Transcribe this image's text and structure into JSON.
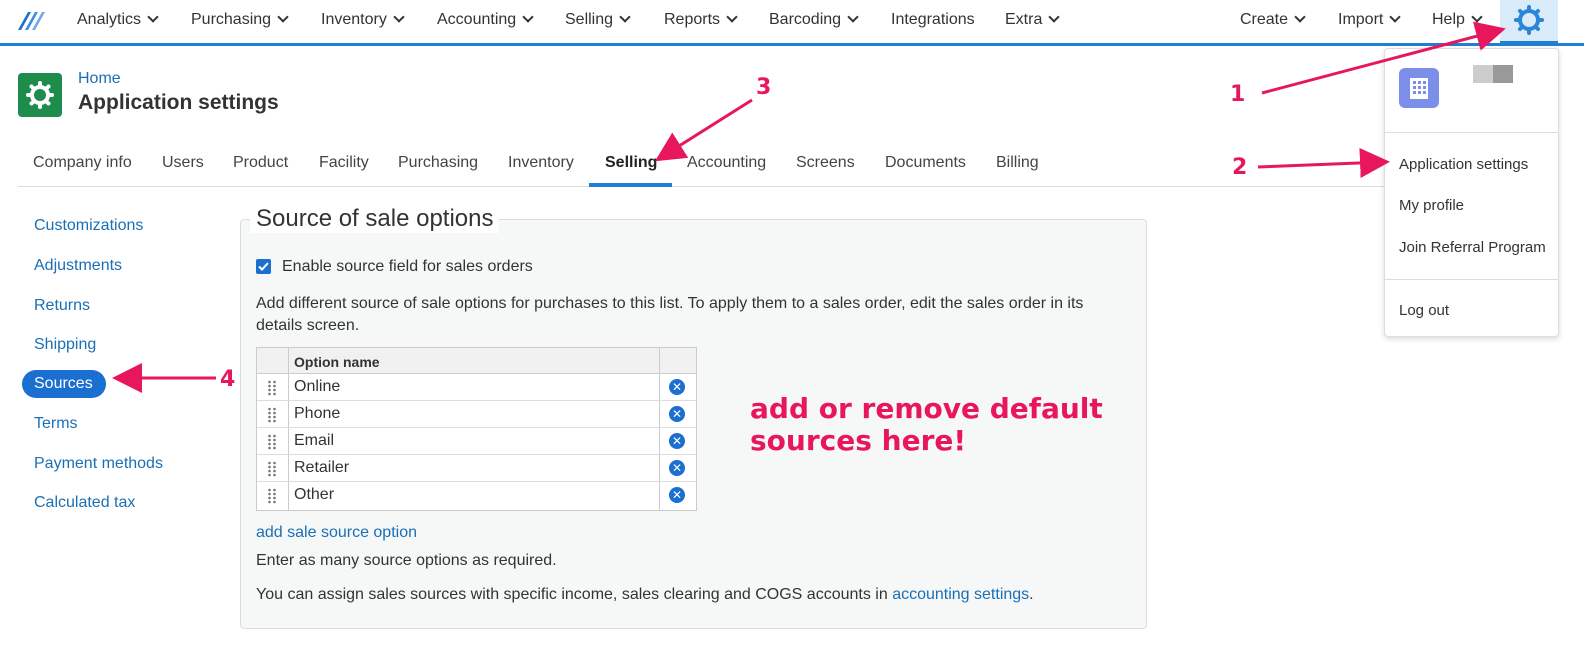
{
  "nav": {
    "items": [
      "Analytics",
      "Purchasing",
      "Inventory",
      "Accounting",
      "Selling",
      "Reports",
      "Barcoding",
      "Integrations",
      "Extra"
    ],
    "right_items": [
      "Create",
      "Import",
      "Help"
    ]
  },
  "header": {
    "breadcrumb": "Home",
    "title": "Application settings"
  },
  "tabs": [
    "Company info",
    "Users",
    "Product",
    "Facility",
    "Purchasing",
    "Inventory",
    "Selling",
    "Accounting",
    "Screens",
    "Documents",
    "Billing"
  ],
  "active_tab": "Selling",
  "sidebar": {
    "items": [
      "Customizations",
      "Adjustments",
      "Returns",
      "Shipping",
      "Sources",
      "Terms",
      "Payment methods",
      "Calculated tax"
    ],
    "active": "Sources"
  },
  "panel": {
    "title": "Source of sale options",
    "checkbox_label": "Enable source field for sales orders",
    "checkbox_checked": true,
    "description": "Add different source of sale options for purchases to this list. To apply them to a sales order, edit the sales order in its details screen.",
    "column_header": "Option name",
    "options": [
      "Online",
      "Phone",
      "Email",
      "Retailer",
      "Other"
    ],
    "add_link": "add sale source option",
    "hint": "Enter as many source options as required.",
    "footer_text": "You can assign sales sources with specific income, sales clearing and COGS accounts in",
    "footer_link": "accounting settings",
    "footer_end": "."
  },
  "dropdown": {
    "items": [
      "Application settings",
      "My profile",
      "Join Referral Program"
    ],
    "logout": "Log out"
  },
  "annotations": {
    "note_line1": "add or remove default",
    "note_line2": "sources here!",
    "numbers": [
      "1",
      "2",
      "3",
      "4"
    ]
  },
  "colors": {
    "accent": "#1f7fd6",
    "annotation": "#e8175d",
    "header_icon": "#1e8c4a"
  }
}
